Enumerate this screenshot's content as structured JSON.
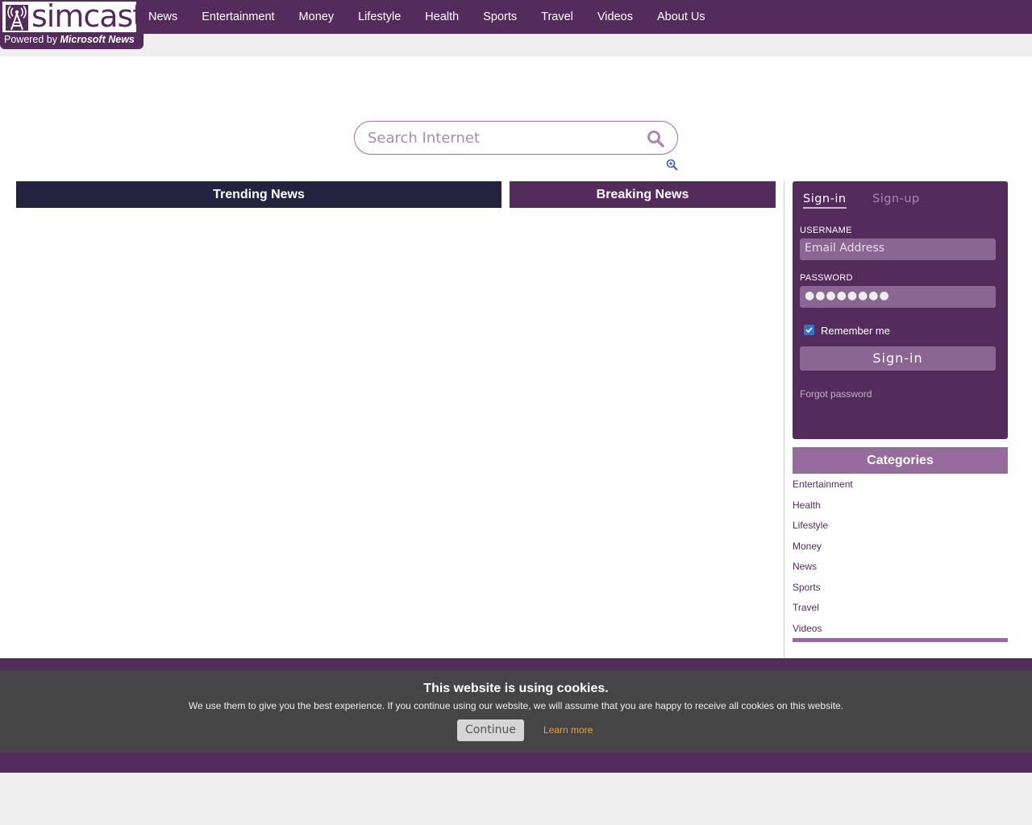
{
  "brand": {
    "name": "simcast",
    "powered_prefix": "Powered by",
    "powered_brand": "Microsoft News"
  },
  "nav": [
    "News",
    "Entertainment",
    "Money",
    "Lifestyle",
    "Health",
    "Sports",
    "Travel",
    "Videos",
    "About Us"
  ],
  "search": {
    "placeholder": "Search Internet"
  },
  "sections": {
    "trending": "Trending News",
    "breaking": "Breaking News"
  },
  "auth": {
    "tab_signin": "Sign-in",
    "tab_signup": "Sign-up",
    "username_label": "USERNAME",
    "username_placeholder": "Email Address",
    "password_label": "PASSWORD",
    "password_value": "●●●●●●●●",
    "remember_label": "Remember me",
    "remember_checked": true,
    "signin_button": "Sign-in",
    "forgot": "Forgot password"
  },
  "categories": {
    "title": "Categories",
    "items": [
      "Entertainment",
      "Health",
      "Lifestyle",
      "Money",
      "News",
      "Sports",
      "Travel",
      "Videos"
    ]
  },
  "cookie": {
    "title": "This website is using cookies.",
    "text": "We use them to give you the best experience. If you continue using our website, we will assume that you are happy to receive all cookies on this website.",
    "continue": "Continue",
    "learn_more": "Learn more"
  },
  "colors": {
    "brand": "#532c5c",
    "trending": "#24233f",
    "categories": "#956c9c",
    "cookie_bg": "#454545",
    "link_accent": "#e8a33a"
  }
}
